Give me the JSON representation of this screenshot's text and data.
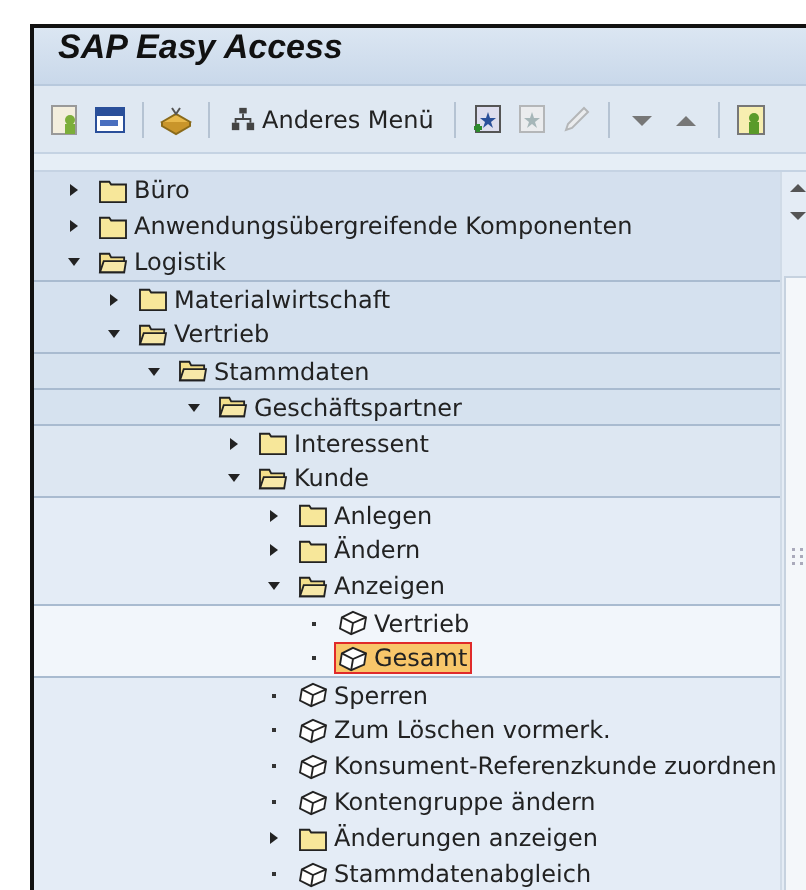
{
  "window": {
    "title": "SAP Easy Access"
  },
  "toolbar": {
    "menu_button": "Anderes Menü"
  },
  "tree": [
    {
      "label": "Büro",
      "kind": "folder",
      "expanded": false,
      "selected": false
    },
    {
      "label": "Anwendungsübergreifende Komponenten",
      "kind": "folder",
      "expanded": false,
      "selected": false
    },
    {
      "label": "Logistik",
      "kind": "folder",
      "expanded": true,
      "selected": false,
      "children": [
        {
          "label": "Materialwirtschaft",
          "kind": "folder",
          "expanded": false,
          "selected": false
        },
        {
          "label": "Vertrieb",
          "kind": "folder",
          "expanded": true,
          "selected": false,
          "children": [
            {
              "label": "Stammdaten",
              "kind": "folder",
              "expanded": true,
              "selected": false,
              "children": [
                {
                  "label": "Geschäftspartner",
                  "kind": "folder",
                  "expanded": true,
                  "selected": false,
                  "children": [
                    {
                      "label": "Interessent",
                      "kind": "folder",
                      "expanded": false,
                      "selected": false
                    },
                    {
                      "label": "Kunde",
                      "kind": "folder",
                      "expanded": true,
                      "selected": false,
                      "children": [
                        {
                          "label": "Anlegen",
                          "kind": "folder",
                          "expanded": false,
                          "selected": false
                        },
                        {
                          "label": "Ändern",
                          "kind": "folder",
                          "expanded": false,
                          "selected": false
                        },
                        {
                          "label": "Anzeigen",
                          "kind": "folder",
                          "expanded": true,
                          "selected": false,
                          "children": [
                            {
                              "label": "Vertrieb",
                              "kind": "item",
                              "selected": false
                            },
                            {
                              "label": "Gesamt",
                              "kind": "item",
                              "selected": true
                            }
                          ]
                        },
                        {
                          "label": "Sperren",
                          "kind": "item",
                          "selected": false
                        },
                        {
                          "label": "Zum Löschen vormerk.",
                          "kind": "item",
                          "selected": false
                        },
                        {
                          "label": "Konsument-Referenzkunde zuordnen",
                          "kind": "item",
                          "selected": false
                        },
                        {
                          "label": "Kontengruppe ändern",
                          "kind": "item",
                          "selected": false
                        },
                        {
                          "label": "Änderungen anzeigen",
                          "kind": "folder",
                          "expanded": false,
                          "selected": false
                        },
                        {
                          "label": "Stammdatenabgleich",
                          "kind": "item",
                          "selected": false
                        }
                      ]
                    }
                  ]
                }
              ]
            }
          ]
        }
      ]
    }
  ]
}
